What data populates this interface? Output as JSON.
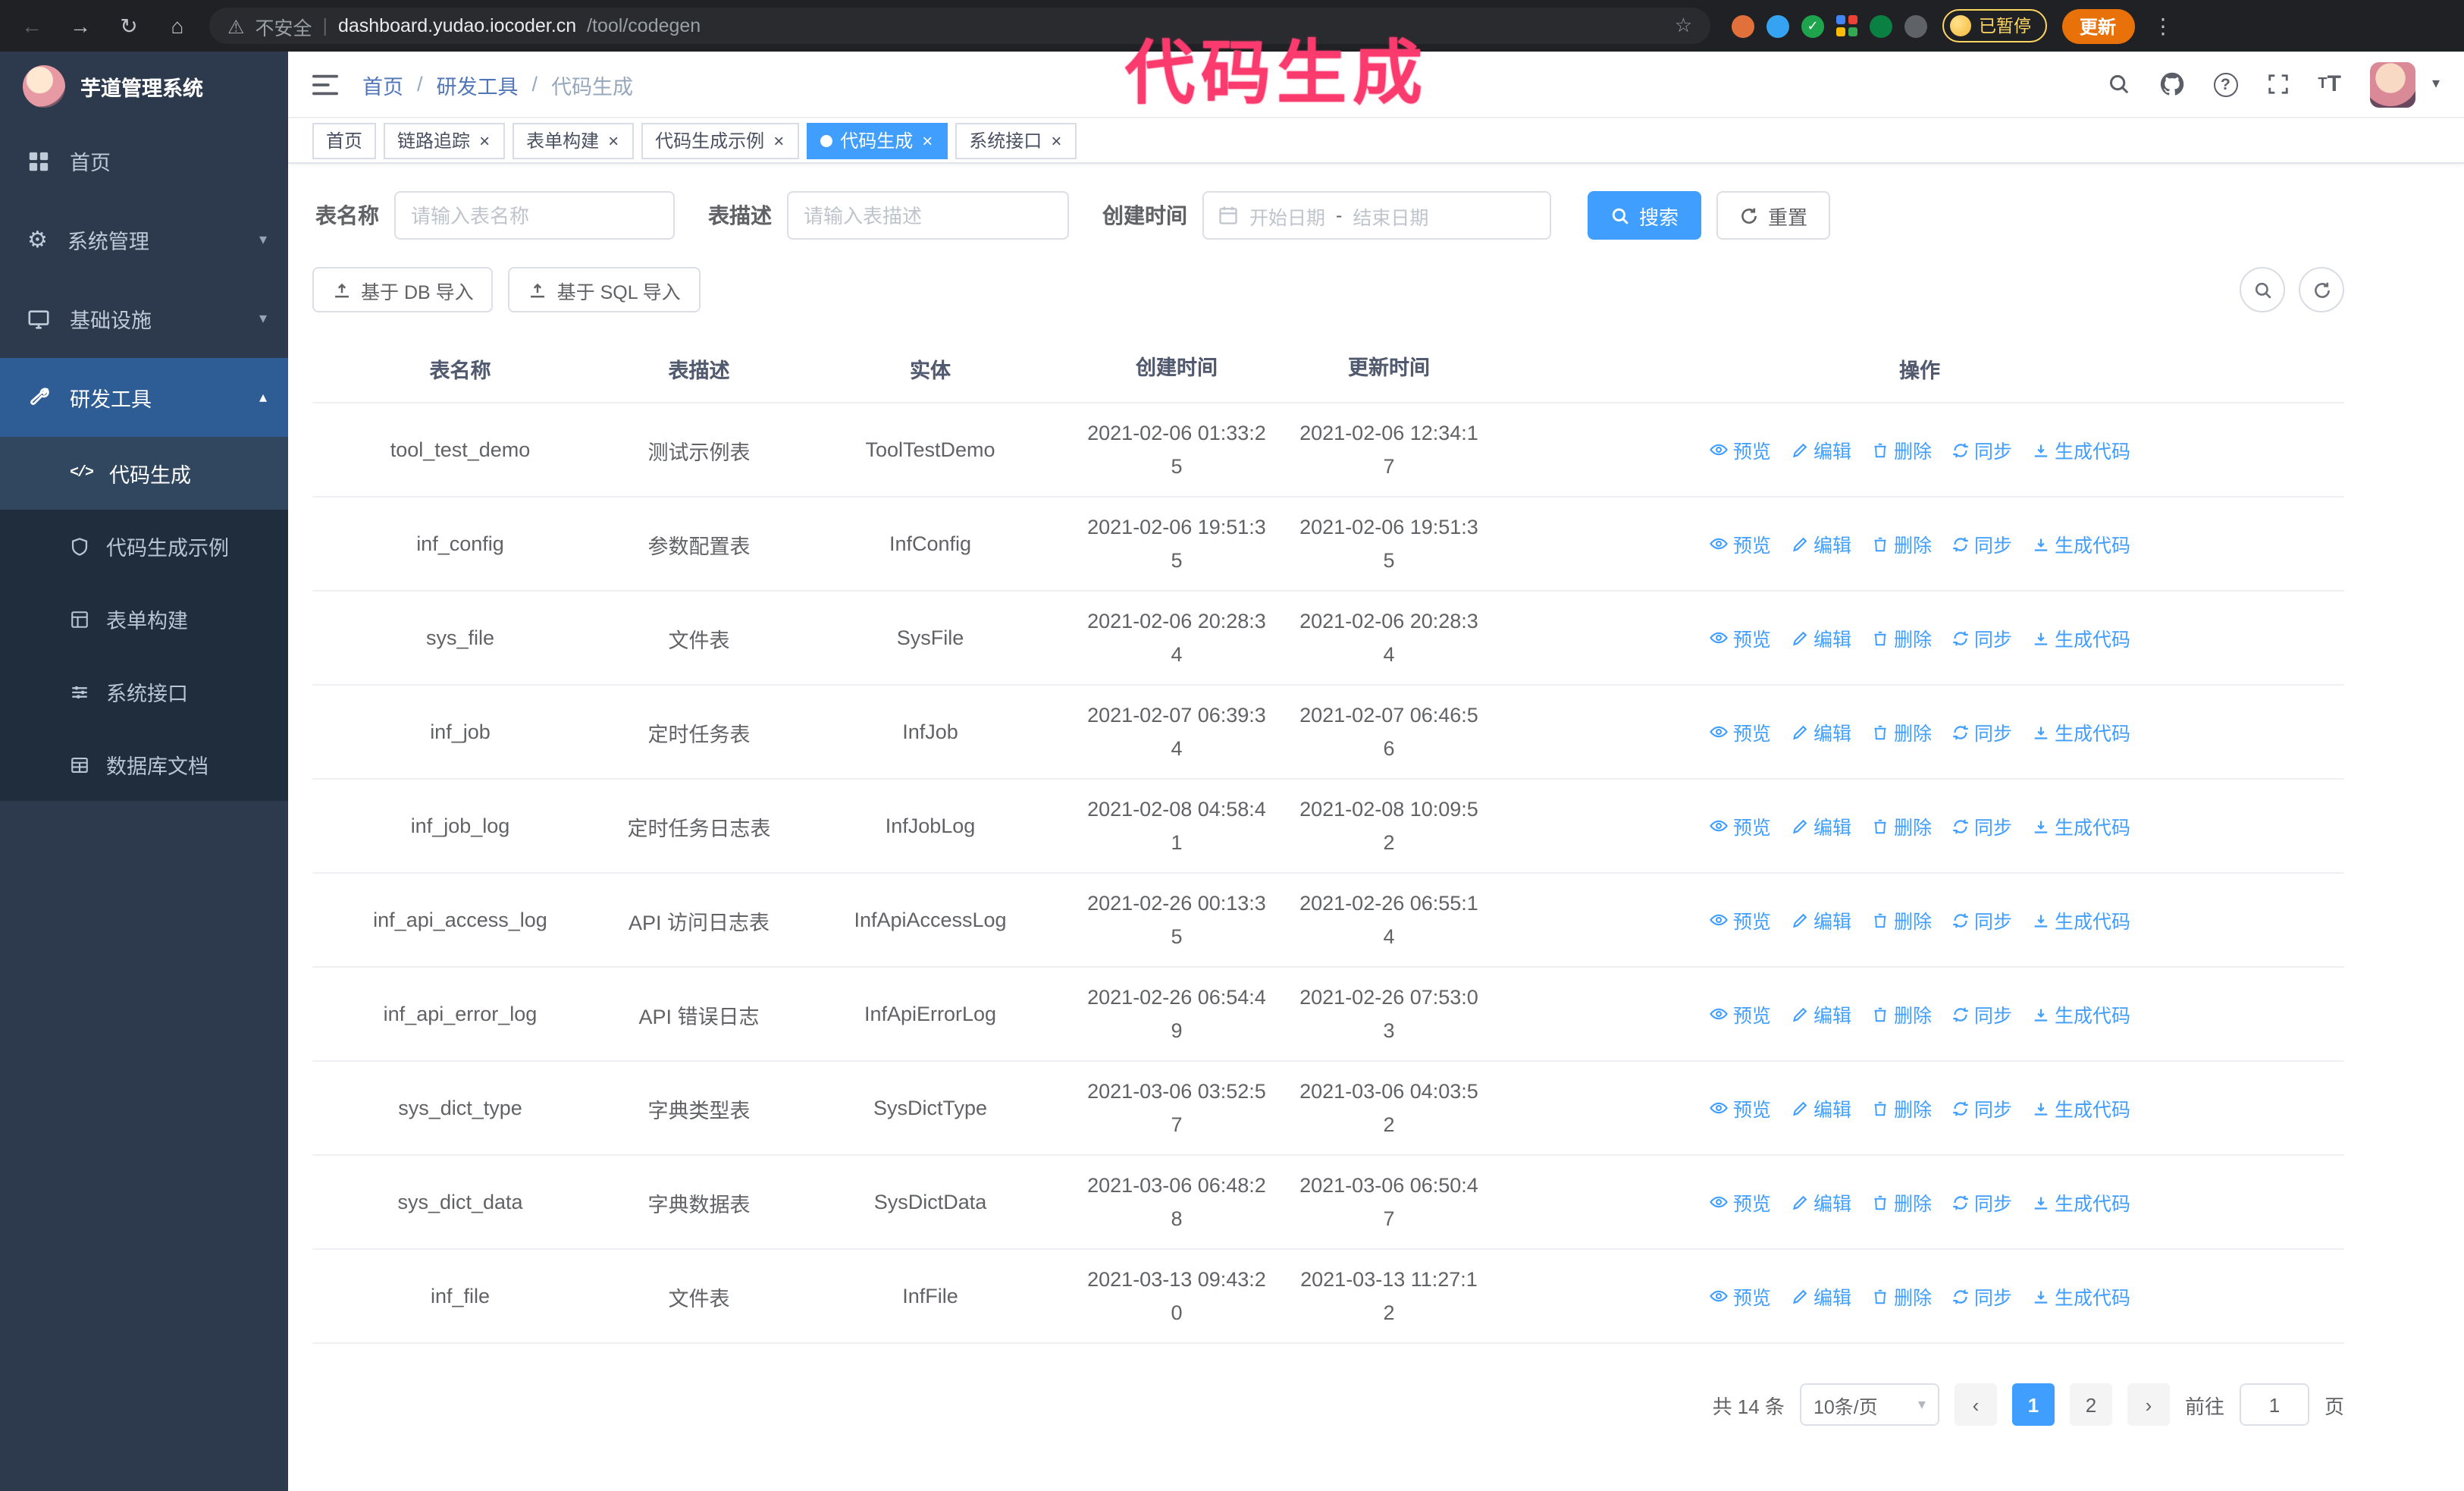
{
  "annotation": {
    "text": "代码生成",
    "color": "#fb3a6e"
  },
  "browser": {
    "security_label": "不安全",
    "url_host": "dashboard.yudao.iocoder.cn",
    "url_path": "/tool/codegen",
    "paused_label": "已暂停",
    "update_label": "更新"
  },
  "sidebar": {
    "title": "芋道管理系统",
    "items": [
      {
        "label": "首页"
      },
      {
        "label": "系统管理"
      },
      {
        "label": "基础设施"
      },
      {
        "label": "研发工具"
      }
    ],
    "subitems": [
      {
        "label": "代码生成"
      },
      {
        "label": "代码生成示例"
      },
      {
        "label": "表单构建"
      },
      {
        "label": "系统接口"
      },
      {
        "label": "数据库文档"
      }
    ]
  },
  "header": {
    "breadcrumb": [
      "首页",
      "研发工具",
      "代码生成"
    ]
  },
  "tabs": [
    {
      "label": "首页",
      "closable": false,
      "active": false
    },
    {
      "label": "链路追踪",
      "closable": true,
      "active": false
    },
    {
      "label": "表单构建",
      "closable": true,
      "active": false
    },
    {
      "label": "代码生成示例",
      "closable": true,
      "active": false
    },
    {
      "label": "代码生成",
      "closable": true,
      "active": true
    },
    {
      "label": "系统接口",
      "closable": true,
      "active": false
    }
  ],
  "filters": {
    "table_name_label": "表名称",
    "table_name_placeholder": "请输入表名称",
    "table_desc_label": "表描述",
    "table_desc_placeholder": "请输入表描述",
    "create_time_label": "创建时间",
    "start_date_placeholder": "开始日期",
    "range_separator": "-",
    "end_date_placeholder": "结束日期",
    "search_label": "搜索",
    "reset_label": "重置"
  },
  "toolbar": {
    "import_db_label": "基于 DB 导入",
    "import_sql_label": "基于 SQL 导入"
  },
  "table": {
    "columns": [
      "表名称",
      "表描述",
      "实体",
      "创建时间",
      "更新时间",
      "操作"
    ],
    "action_labels": [
      "预览",
      "编辑",
      "删除",
      "同步",
      "生成代码"
    ],
    "rows": [
      {
        "name": "tool_test_demo",
        "desc": "测试示例表",
        "entity": "ToolTestDemo",
        "created": "2021-02-06 01:33:25",
        "updated": "2021-02-06 12:34:17"
      },
      {
        "name": "inf_config",
        "desc": "参数配置表",
        "entity": "InfConfig",
        "created": "2021-02-06 19:51:35",
        "updated": "2021-02-06 19:51:35"
      },
      {
        "name": "sys_file",
        "desc": "文件表",
        "entity": "SysFile",
        "created": "2021-02-06 20:28:34",
        "updated": "2021-02-06 20:28:34"
      },
      {
        "name": "inf_job",
        "desc": "定时任务表",
        "entity": "InfJob",
        "created": "2021-02-07 06:39:34",
        "updated": "2021-02-07 06:46:56"
      },
      {
        "name": "inf_job_log",
        "desc": "定时任务日志表",
        "entity": "InfJobLog",
        "created": "2021-02-08 04:58:41",
        "updated": "2021-02-08 10:09:52"
      },
      {
        "name": "inf_api_access_log",
        "desc": "API 访问日志表",
        "entity": "InfApiAccessLog",
        "created": "2021-02-26 00:13:35",
        "updated": "2021-02-26 06:55:14"
      },
      {
        "name": "inf_api_error_log",
        "desc": "API 错误日志",
        "entity": "InfApiErrorLog",
        "created": "2021-02-26 06:54:49",
        "updated": "2021-02-26 07:53:03"
      },
      {
        "name": "sys_dict_type",
        "desc": "字典类型表",
        "entity": "SysDictType",
        "created": "2021-03-06 03:52:57",
        "updated": "2021-03-06 04:03:52"
      },
      {
        "name": "sys_dict_data",
        "desc": "字典数据表",
        "entity": "SysDictData",
        "created": "2021-03-06 06:48:28",
        "updated": "2021-03-06 06:50:47"
      },
      {
        "name": "inf_file",
        "desc": "文件表",
        "entity": "InfFile",
        "created": "2021-03-13 09:43:20",
        "updated": "2021-03-13 11:27:12"
      }
    ]
  },
  "pagination": {
    "total_label": "共 14 条",
    "page_size_label": "10条/页",
    "pages": [
      {
        "label": "1",
        "active": true
      },
      {
        "label": "2",
        "active": false
      }
    ],
    "goto_label": "前往",
    "goto_value": "1",
    "page_unit": "页"
  }
}
